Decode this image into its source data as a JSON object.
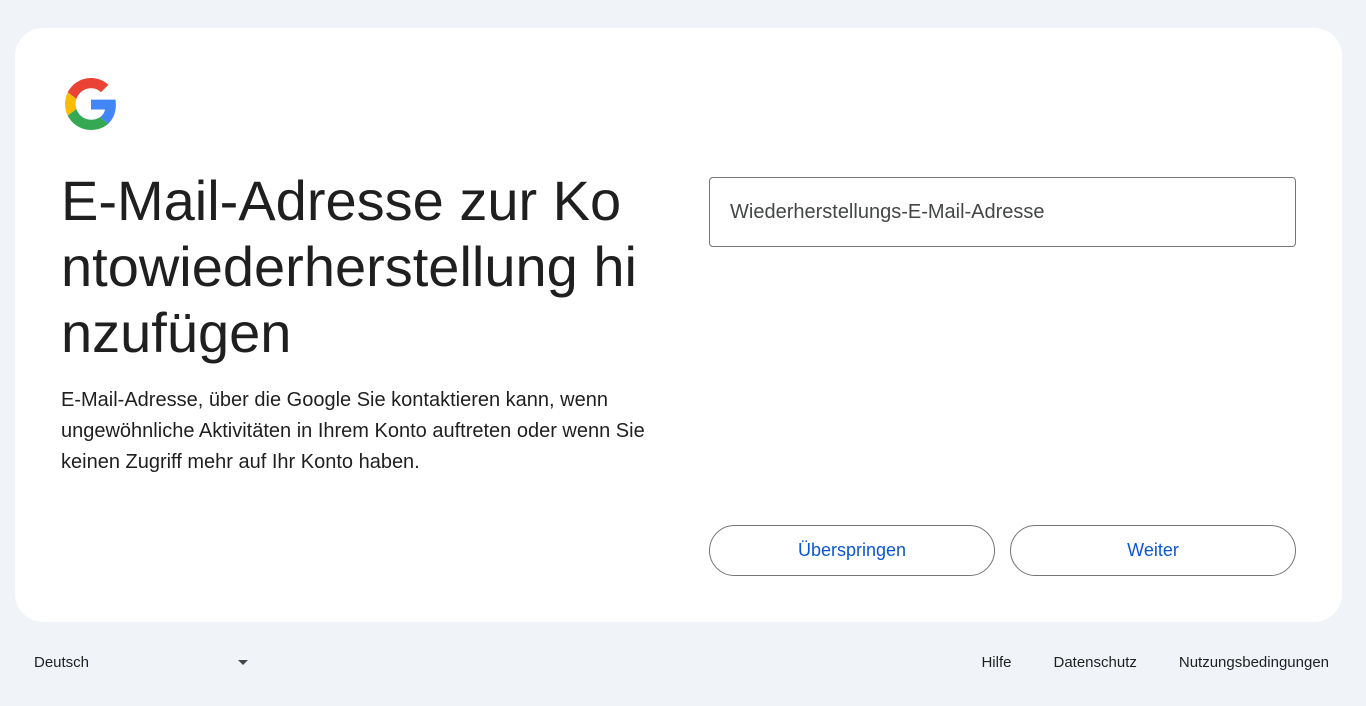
{
  "heading": "E-Mail-Adresse zur Kontowiederherstellung hinzufügen",
  "description": "E-Mail-Adresse, über die Google Sie kontaktieren kann, wenn ungewöhnliche Aktivitäten in Ihrem Konto auftreten oder wenn Sie keinen Zugriff mehr auf Ihr Konto haben.",
  "recovery_email": {
    "placeholder": "Wiederherstellungs-E-Mail-Adresse",
    "value": ""
  },
  "buttons": {
    "skip_label": "Überspringen",
    "next_label": "Weiter"
  },
  "footer": {
    "language": "Deutsch",
    "links": {
      "help": "Hilfe",
      "privacy": "Datenschutz",
      "terms": "Nutzungsbedingungen"
    }
  },
  "colors": {
    "background": "#f0f4f9",
    "card": "#ffffff",
    "accent": "#0b57d0",
    "text": "#1f1f1f",
    "border": "#747775"
  },
  "icons": {
    "logo": "google-logo-icon",
    "language_dropdown": "caret-down-icon"
  }
}
